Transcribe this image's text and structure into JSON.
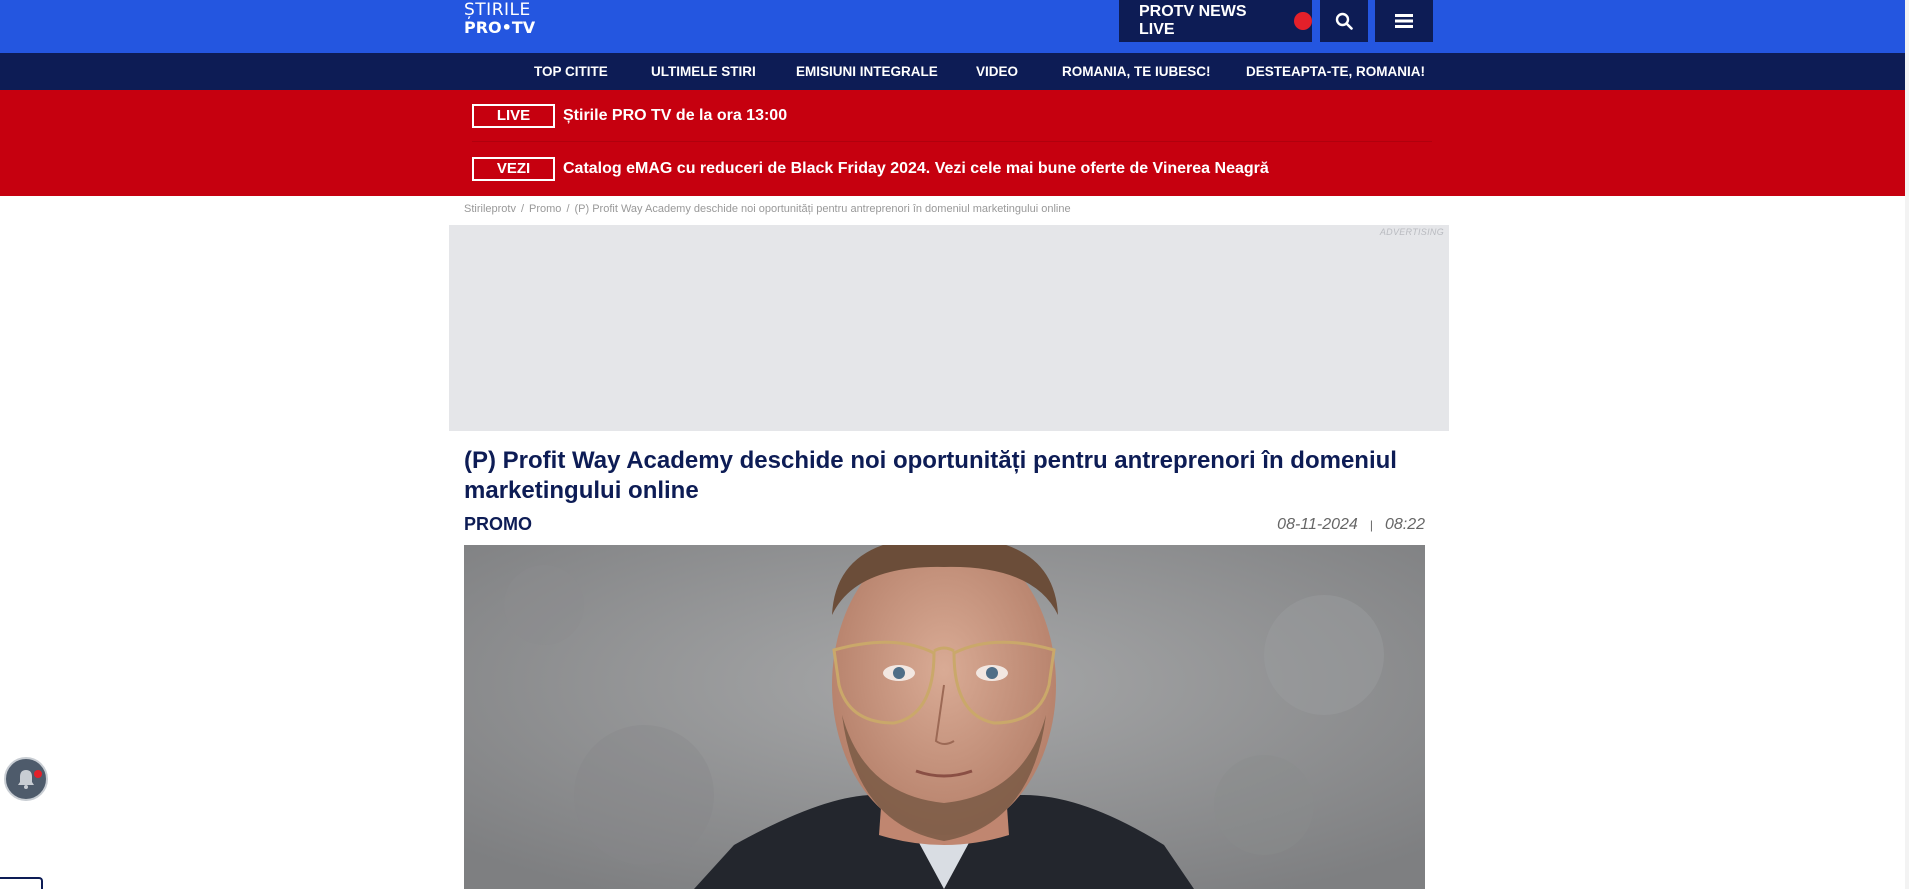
{
  "header": {
    "logo_line1": "ȘTIRILE",
    "logo_line2": "PRO•TV",
    "live_button": "PROTV NEWS LIVE",
    "search_icon": "search-icon",
    "menu_icon": "hamburger-menu-icon",
    "colors": {
      "primary_blue": "#2456e0",
      "navy": "#0d1c55",
      "live_dot": "#e4202a"
    }
  },
  "nav": {
    "items": [
      {
        "label": "TOP CITITE"
      },
      {
        "label": "ULTIMELE STIRI"
      },
      {
        "label": "EMISIUNI INTEGRALE"
      },
      {
        "label": "VIDEO"
      },
      {
        "label": "ROMANIA, TE IUBESC!"
      },
      {
        "label": "DESTEAPTA-TE, ROMANIA!"
      }
    ]
  },
  "breaking": {
    "color": "#c6000f",
    "items": [
      {
        "tag": "LIVE",
        "text": "Știrile PRO TV de la ora 13:00"
      },
      {
        "tag": "VEZI",
        "text": "Catalog eMAG cu reduceri de Black Friday 2024. Vezi cele mai bune oferte de Vinerea Neagră"
      }
    ]
  },
  "breadcrumb": {
    "items": [
      {
        "label": "Stirileprotv"
      },
      {
        "label": "Promo"
      },
      {
        "label": "(P) Profit Way Academy deschide noi oportunități pentru antreprenori în domeniul marketingului online"
      }
    ],
    "separator": "/"
  },
  "ad": {
    "label": "ADVERTISING"
  },
  "article": {
    "title": "(P) Profit Way Academy deschide noi oportunități pentru antreprenori în domeniul marketingului online",
    "category": "PROMO",
    "date": "08-11-2024",
    "separator": "|",
    "time": "08:22",
    "image_icon": "article-photo"
  },
  "floating": {
    "bell_icon": "notification-bell-icon"
  }
}
